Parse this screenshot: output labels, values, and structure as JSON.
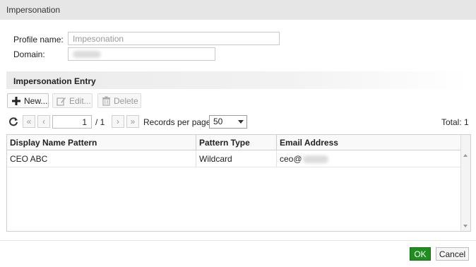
{
  "dialog": {
    "title": "Impersonation"
  },
  "form": {
    "profile_label": "Profile name:",
    "profile_value": "Impesonation",
    "domain_label": "Domain:",
    "domain_value": ""
  },
  "section": {
    "title": "Impersonation Entry"
  },
  "toolbar": {
    "new_label": "New...",
    "edit_label": "Edit...",
    "delete_label": "Delete"
  },
  "pager": {
    "current_page": "1",
    "total_pages_text": "/ 1",
    "records_per_page_label": "Records per page:",
    "records_per_page_value": "50",
    "total_text": "Total: 1"
  },
  "table": {
    "columns": [
      "Display Name Pattern",
      "Pattern Type",
      "Email Address"
    ],
    "rows": [
      {
        "display_name": "CEO ABC",
        "pattern_type": "Wildcard",
        "email_prefix": "ceo@"
      }
    ]
  },
  "footer": {
    "ok_label": "OK",
    "cancel_label": "Cancel"
  },
  "colors": {
    "ok_green": "#1e8f1e",
    "section_header_bg": "#ebebeb",
    "title_bg": "#e6e6e6"
  },
  "icons": [
    "refresh-icon",
    "first-page-icon",
    "prev-page-icon",
    "next-page-icon",
    "last-page-icon",
    "plus-icon",
    "edit-icon",
    "trash-icon"
  ]
}
